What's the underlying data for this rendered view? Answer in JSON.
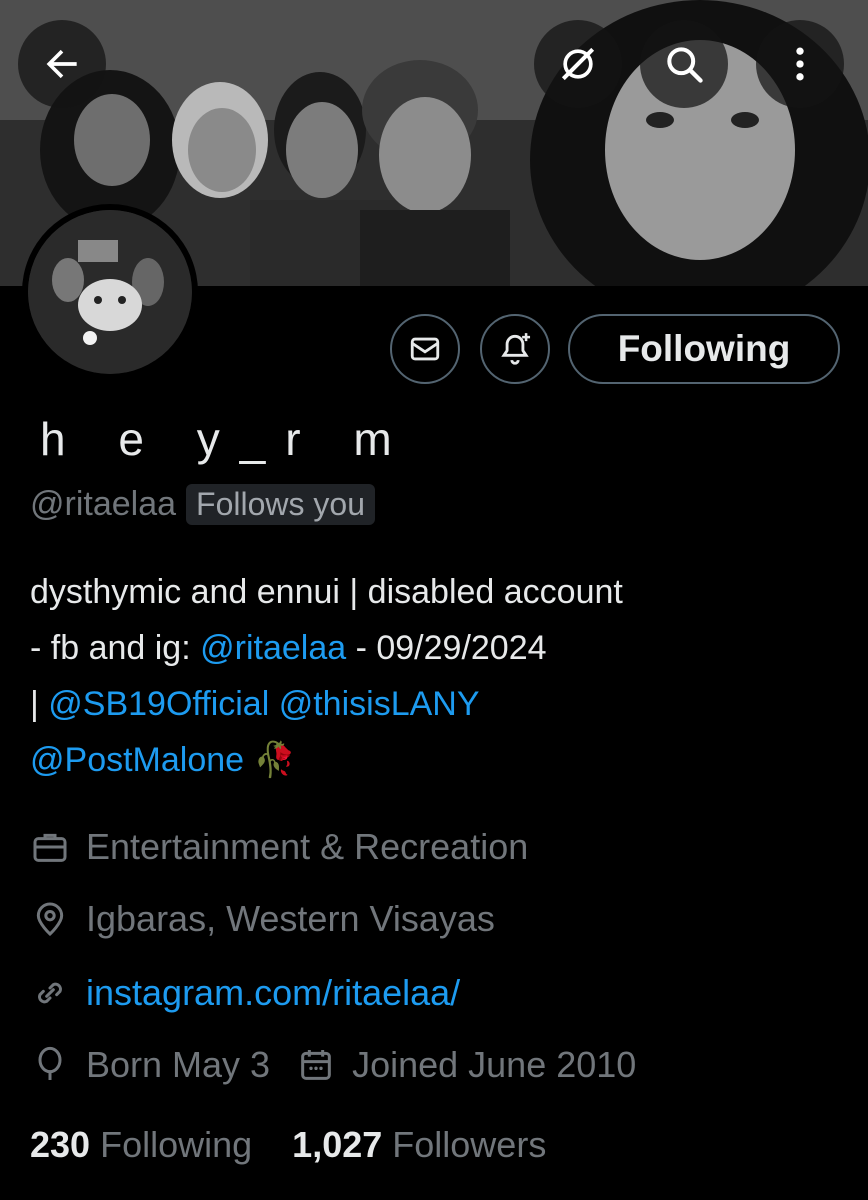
{
  "header": {
    "back_icon": "arrow-left-icon",
    "grok_icon": "grok-icon",
    "search_icon": "search-icon",
    "more_icon": "more-vertical-icon"
  },
  "profile": {
    "display_name": "h e y_r m",
    "handle": "@ritaelaa",
    "follows_you": "Follows you",
    "following_label": "Following",
    "message_icon": "envelope-icon",
    "notify_icon": "bell-plus-icon"
  },
  "bio": {
    "line1": "dysthymic and ennui | disabled account",
    "line2_prefix": "- fb and ig: ",
    "line2_link": "@ritaelaa",
    "line2_suffix": " - 09/29/2024",
    "line3_prefix": "| ",
    "line3_link1": "@SB19Official",
    "line3_link2": "@thisisLANY",
    "line4_link": "@PostMalone",
    "emoji": "🥀"
  },
  "meta": {
    "category": "Entertainment & Recreation",
    "location": "Igbaras, Western Visayas",
    "website": "instagram.com/ritaelaa/",
    "born": "Born May 3",
    "joined": "Joined June 2010"
  },
  "stats": {
    "following_count": "230",
    "following_label": "Following",
    "followers_count": "1,027",
    "followers_label": "Followers"
  },
  "colors": {
    "background": "#000000",
    "text": "#e7e9ea",
    "muted": "#71767b",
    "link": "#1d9bf0",
    "border": "#536471"
  }
}
